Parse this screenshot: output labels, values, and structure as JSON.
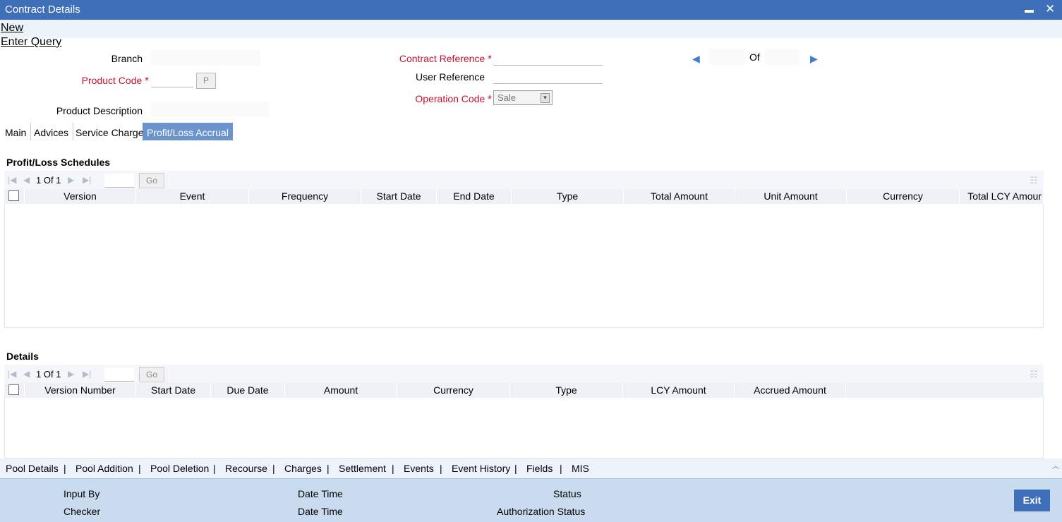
{
  "window": {
    "title": "Contract Details",
    "minimize_glyph": "▬",
    "close_glyph": "✕"
  },
  "menu": {
    "new": "New",
    "enter_query": "Enter Query"
  },
  "form": {
    "branch_label": "Branch",
    "product_code_label": "Product Code",
    "product_button": "P",
    "product_description_label": "Product Description",
    "contract_reference_label": "Contract Reference",
    "user_reference_label": "User Reference",
    "operation_code_label": "Operation Code",
    "operation_code_value": "Sale",
    "of_label": "Of",
    "required_mark": "*"
  },
  "tabs": [
    {
      "label": "Main"
    },
    {
      "label": "Advices"
    },
    {
      "label": "Service Charge"
    },
    {
      "label": "Profit/Loss Accrual"
    }
  ],
  "schedules": {
    "title": "Profit/Loss Schedules",
    "pager": "1 Of 1",
    "go": "Go",
    "columns": [
      "Version",
      "Event",
      "Frequency",
      "Start Date",
      "End Date",
      "Type",
      "Total Amount",
      "Unit Amount",
      "Currency",
      "Total LCY Amour"
    ]
  },
  "details": {
    "title": "Details",
    "pager": "1 Of 1",
    "go": "Go",
    "columns": [
      "Version Number",
      "Start Date",
      "Due Date",
      "Amount",
      "Currency",
      "Type",
      "LCY Amount",
      "Accrued Amount"
    ]
  },
  "bottom_links": [
    "Pool Details",
    "Pool Addition",
    "Pool Deletion",
    "Recourse",
    "Charges",
    "Settlement",
    "Events",
    "Event History",
    "Fields",
    "MIS"
  ],
  "bottom_sep": "|",
  "footer": {
    "input_by": "Input By",
    "checker": "Checker",
    "date_time_1": "Date Time",
    "date_time_2": "Date Time",
    "status": "Status",
    "authorization_status": "Authorization Status",
    "exit": "Exit"
  },
  "colors": {
    "titlebar": "#3f6fb8",
    "active_tab": "#6b93cc",
    "required": "#c8102e",
    "footer": "#c9dcef"
  }
}
